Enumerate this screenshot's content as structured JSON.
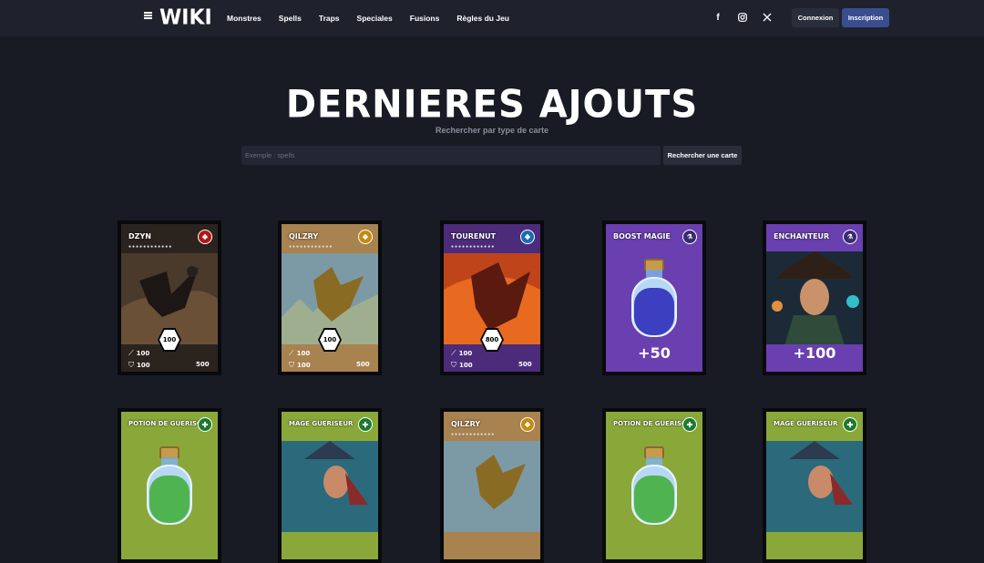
{
  "nav": {
    "logo": "WIKI",
    "menu": [
      "Monstres",
      "Spells",
      "Traps",
      "Speciales",
      "Fusions",
      "Règles du Jeu"
    ],
    "social": [
      "facebook-icon",
      "instagram-icon",
      "x-icon"
    ],
    "login": "Connexion",
    "signup": "Inscription"
  },
  "hero": {
    "title": "DERNIERES AJOUTS",
    "subtitle": "Rechercher par type de carte",
    "search_placeholder": "Exemple : spells",
    "search_button": "Rechercher une carte"
  },
  "cards": [
    {
      "name": "DZYN",
      "kind": "monster",
      "level": "100",
      "atk": "100",
      "def": "100",
      "cost": "500",
      "element": "fire",
      "color": "#e0302a",
      "bg": "#2b231e"
    },
    {
      "name": "QILZRY",
      "kind": "monster",
      "level": "100",
      "atk": "100",
      "def": "100",
      "cost": "500",
      "element": "earth",
      "color": "#e0a420",
      "bg": "#a8824f"
    },
    {
      "name": "TOURENUT",
      "kind": "monster",
      "level": "800",
      "atk": "100",
      "def": "100",
      "cost": "500",
      "element": "water",
      "color": "#3aa0e0",
      "bg": "#4c2c7a"
    },
    {
      "name": "BOOST MAGIE",
      "kind": "spell",
      "bonus": "+50",
      "bg": "#6a3fb0",
      "liquid": "#3b3fc0"
    },
    {
      "name": "ENCHANTEUR",
      "kind": "spell-portrait",
      "bonus": "+100",
      "bg": "#6a3fb0"
    },
    {
      "name": "POTION DE GUERISON",
      "kind": "potion",
      "bg": "#8aa83a",
      "liquid": "#4fb44f"
    },
    {
      "name": "MAGE GUERISEUR",
      "kind": "portrait",
      "bg": "#8aa83a"
    },
    {
      "name": "QILZRY",
      "kind": "monster-cut",
      "element": "earth",
      "color": "#e0a420",
      "bg": "#a8824f"
    },
    {
      "name": "POTION DE GUERISON",
      "kind": "potion",
      "bg": "#8aa83a",
      "liquid": "#4fb44f"
    },
    {
      "name": "MAGE GUERISEUR",
      "kind": "portrait",
      "bg": "#8aa83a"
    }
  ]
}
